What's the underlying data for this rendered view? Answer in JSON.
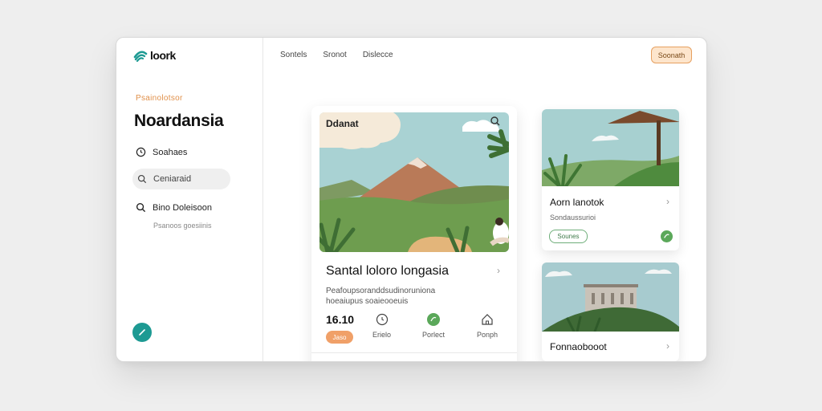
{
  "app": {
    "logo_text": "loork"
  },
  "sidebar": {
    "eyebrow": "Psainolotsor",
    "title": "Noardansia",
    "items": [
      {
        "label": "Soahaes",
        "icon": "clock-icon"
      },
      {
        "label": "Ceniaraid",
        "icon": "search-icon"
      },
      {
        "label": "Bino Doleisoon",
        "icon": "search-icon",
        "sublabel": "Psanoos goesiinis"
      }
    ]
  },
  "topnav": {
    "links": [
      "Sontels",
      "Sronot",
      "Dislecce"
    ],
    "cta_label": "Soonath"
  },
  "main_card": {
    "image_label": "Ddanat",
    "title": "Santal loloro longasia",
    "description": "Peafoupsoranddsudinoruniona hoeaiupus soaieooeuis",
    "price": "16.10",
    "badge": "Jaso",
    "stats": [
      {
        "label": "Erielo",
        "icon": "clock-icon"
      },
      {
        "label": "Porlect",
        "icon": "leaf-icon"
      },
      {
        "label": "Ponph",
        "icon": "home-icon"
      }
    ]
  },
  "side_cards": [
    {
      "title": "Aorn lanotok",
      "subtitle": "Sondaussurioi",
      "pill": "Sounes",
      "icon": "leaf-icon"
    },
    {
      "title": "Fonnaobooot",
      "subtitle": ""
    }
  ],
  "colors": {
    "accent_teal": "#1d9a93",
    "accent_orange": "#f0a068",
    "accent_green": "#5ba85a"
  }
}
